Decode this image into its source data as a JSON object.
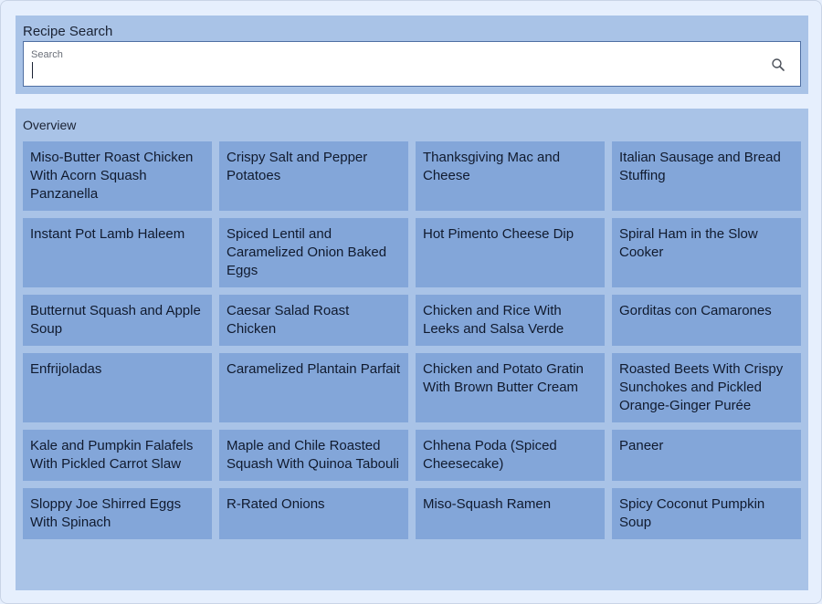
{
  "search": {
    "title": "Recipe Search",
    "placeholder": "Search",
    "value": ""
  },
  "overview": {
    "title": "Overview",
    "rows": [
      [
        "Miso-Butter Roast Chicken With Acorn Squash Panzanella",
        "Crispy Salt and Pepper Potatoes",
        "Thanksgiving Mac and Cheese",
        "Italian Sausage and Bread Stuffing"
      ],
      [
        "Instant Pot Lamb Haleem",
        "Spiced Lentil and Caramelized Onion Baked Eggs",
        "Hot Pimento Cheese Dip",
        "Spiral Ham in the Slow Cooker"
      ],
      [
        "Butternut Squash and Apple Soup",
        "Caesar Salad Roast Chicken",
        "Chicken and Rice With Leeks and Salsa Verde",
        "Gorditas con Camarones"
      ],
      [
        "Enfrijoladas",
        "Caramelized Plantain Parfait",
        "Chicken and Potato Gratin With Brown Butter Cream",
        "Roasted Beets With Crispy Sunchokes and Pickled Orange-Ginger Purée"
      ],
      [
        "Kale and Pumpkin Falafels With Pickled Carrot Slaw",
        "Maple and Chile Roasted Squash With Quinoa Tabouli",
        "Chhena Poda (Spiced Cheesecake)",
        "Paneer"
      ],
      [
        "Sloppy Joe Shirred Eggs With Spinach",
        "R-Rated Onions",
        "Miso-Squash Ramen",
        "Spicy Coconut Pumpkin Soup"
      ]
    ]
  },
  "icons": {
    "search": "search-icon"
  },
  "colors": {
    "background": "#e6effd",
    "panel": "#a9c3e7",
    "card": "#83a6d9",
    "input_border": "#4f6fa3"
  }
}
